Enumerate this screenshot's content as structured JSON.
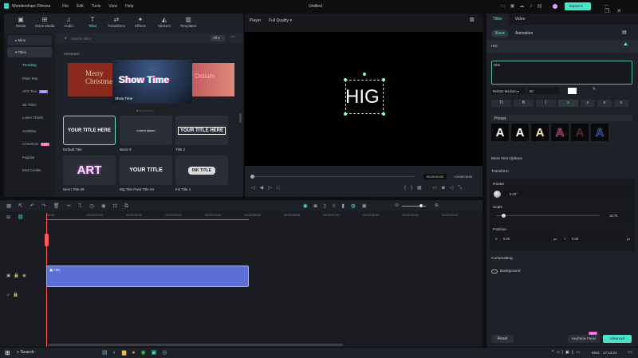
{
  "app": {
    "name": "Wondershare Filmora",
    "document_title": "Untitled",
    "menu": [
      "File",
      "Edit",
      "Tools",
      "View",
      "Help"
    ],
    "export_label": "Export"
  },
  "toolbar": [
    {
      "label": "Media",
      "icon": "media-icon"
    },
    {
      "label": "Stock Media",
      "icon": "stock-media-icon"
    },
    {
      "label": "Audio",
      "icon": "audio-icon"
    },
    {
      "label": "Titles",
      "icon": "titles-icon",
      "active": true
    },
    {
      "label": "Transitions",
      "icon": "transitions-icon"
    },
    {
      "label": "Effects",
      "icon": "effects-icon"
    },
    {
      "label": "Stickers",
      "icon": "stickers-icon"
    },
    {
      "label": "Templates",
      "icon": "templates-icon"
    }
  ],
  "sidebar": {
    "mine": "Mine",
    "titles": "Titles",
    "items": [
      {
        "label": "Trending",
        "active": true
      },
      {
        "label": "Plain Text"
      },
      {
        "label": "VFX Text",
        "badge": "NEW"
      },
      {
        "label": "3D Titles"
      },
      {
        "label": "Lower Thirds"
      },
      {
        "label": "Subtitles"
      },
      {
        "label": "Christmas",
        "badge": "HOT"
      },
      {
        "label": "Popular"
      },
      {
        "label": "End Credits"
      }
    ]
  },
  "library": {
    "search_placeholder": "Search titles",
    "filter": "All",
    "section": "TRENDING",
    "banner": {
      "title": "Show Time",
      "left": "Merry Christmas",
      "right": "Ostium"
    },
    "cards": [
      {
        "label": "Default Title",
        "text": "YOUR TITLE HERE"
      },
      {
        "label": "Basic 6",
        "text": "Lorem ipsum"
      },
      {
        "label": "Title 2",
        "text": "YOUR TITLE HERE"
      },
      {
        "label": "Neon Title 09",
        "text": "ART"
      },
      {
        "label": "Big Title Pack Title 04",
        "text": "YOUR TITLE"
      },
      {
        "label": "Ink Title 1",
        "text": "INK TITLE"
      }
    ]
  },
  "player": {
    "label": "Player",
    "quality": "Full Quality",
    "preview_text": "HIG",
    "current_time": "00:00:00:00",
    "total_time": "/ 00:00:05:00"
  },
  "timeline": {
    "ruler": [
      "00:00",
      "00:00:01:00",
      "00:00:02:00",
      "00:00:03:00",
      "00:00:04:00",
      "00:00:05:00",
      "00:00:06:00",
      "00:00:07:00",
      "00:00:08:00",
      "00:00:09:00",
      "00:00:10:00"
    ],
    "clip_label": "HIG",
    "clip_color": "#5b6fd6"
  },
  "right": {
    "tabs": [
      "Titles",
      "Video"
    ],
    "subtabs": [
      "Basic",
      "Animation"
    ],
    "section": "HIG",
    "text_value": "HIG",
    "font": "Roboto Medium",
    "size": "80",
    "preset_label": "Preset",
    "more_text": "More Text Options",
    "transform": "Transform",
    "rotate": "Rotate",
    "rotate_value": "0.00°",
    "scale": "Scale",
    "scale_value": "15.76",
    "scale_fraction": 0.05,
    "position": "Position",
    "x_label": "X",
    "x_value": "0.00",
    "y_label": "Y",
    "y_value": "0.00",
    "px": "px",
    "compositing": "Compositing",
    "background": "Background",
    "reset": "Reset",
    "keyframe": "Keyframe Panel",
    "keyframe_badge": "NEW",
    "advanced": "Advanced"
  },
  "taskbar": {
    "search": "Search",
    "lang": "ENG",
    "time": "17:13:24"
  },
  "colors": {
    "accent": "#6fe3d0",
    "clip": "#5b6fd6",
    "playhead": "#ff5a5a"
  }
}
